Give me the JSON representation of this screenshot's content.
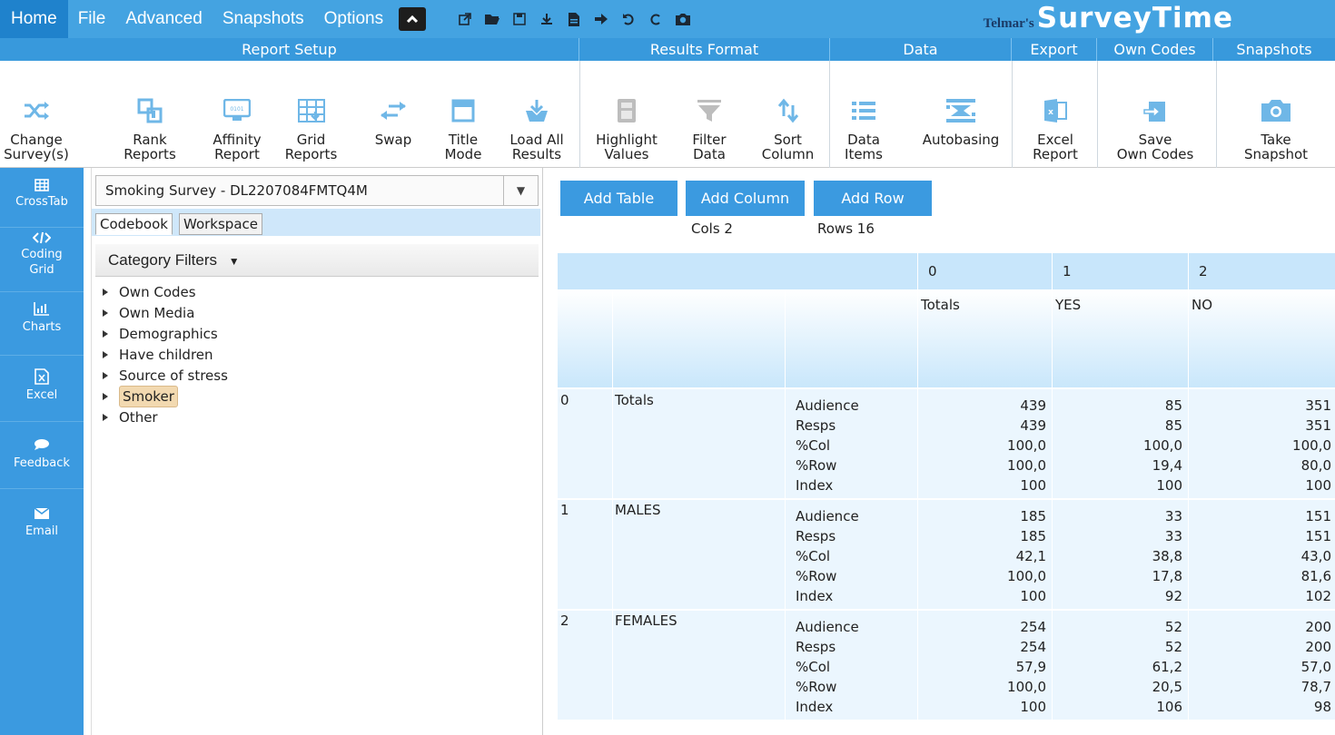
{
  "menu": {
    "tabs": [
      "Home",
      "File",
      "Advanced",
      "Snapshots",
      "Options"
    ],
    "brand_prefix": "Telmar's",
    "brand_name": "SurveyTime"
  },
  "ribbon_groups": [
    "Report Setup",
    "Results Format",
    "Data",
    "Export",
    "Own Codes",
    "Snapshots"
  ],
  "ribbon_buttons": [
    {
      "label": "Change\nSurvey(s)",
      "icon": "shuffle-icon"
    },
    {
      "label": "Rank\nReports",
      "icon": "rank-reports-icon"
    },
    {
      "label": "Affinity\nReport",
      "icon": "monitor-icon"
    },
    {
      "label": "Grid\nReports",
      "icon": "grid-reports-icon"
    },
    {
      "label": "Swap",
      "icon": "swap-icon"
    },
    {
      "label": "Title\nMode",
      "icon": "title-mode-icon"
    },
    {
      "label": "Load All\nResults",
      "icon": "load-all-icon"
    },
    {
      "label": "Highlight\nValues",
      "icon": "calculator-icon"
    },
    {
      "label": "Filter\nData",
      "icon": "filter-icon"
    },
    {
      "label": "Sort\nColumn",
      "icon": "sort-icon"
    },
    {
      "label": "Data\nItems",
      "icon": "list-icon"
    },
    {
      "label": "Autobasing",
      "icon": "autobasing-icon"
    },
    {
      "label": "Excel\nReport",
      "icon": "excel-icon"
    },
    {
      "label": "Save\nOwn Codes",
      "icon": "save-codes-icon"
    },
    {
      "label": "Take\nSnapshot",
      "icon": "camera-icon"
    }
  ],
  "sidenav": [
    {
      "label": "CrossTab",
      "icon": "table-icon"
    },
    {
      "label": "Coding\nGrid",
      "icon": "code-icon"
    },
    {
      "label": "Charts",
      "icon": "bar-chart-icon"
    },
    {
      "label": "Excel",
      "icon": "excel-file-icon"
    },
    {
      "label": "Feedback",
      "icon": "chat-icon"
    },
    {
      "label": "Email",
      "icon": "envelope-icon"
    }
  ],
  "codebook": {
    "survey": "Smoking Survey - DL2207084FMTQ4M",
    "tabs": [
      "Codebook",
      "Workspace"
    ],
    "filter_label": "Category Filters",
    "tree": [
      "Own Codes",
      "Own Media",
      "Demographics",
      "Have children",
      "Source of stress",
      "Smoker",
      "Other"
    ],
    "selected": "Smoker"
  },
  "actions": {
    "add_table": "Add Table",
    "add_column": "Add Column",
    "add_row": "Add Row",
    "cols": "Cols 2",
    "rows": "Rows 16"
  },
  "crosstab": {
    "col_indices": [
      "0",
      "1",
      "2"
    ],
    "col_labels": [
      "Totals",
      "YES",
      "NO"
    ],
    "stats": [
      "Audience",
      "Resps",
      "%Col",
      "%Row",
      "Index"
    ],
    "rows": [
      {
        "idx": "0",
        "label": "Totals",
        "values": [
          [
            "439",
            "439",
            "100,0",
            "100,0",
            "100"
          ],
          [
            "85",
            "85",
            "100,0",
            "19,4",
            "100"
          ],
          [
            "351",
            "351",
            "100,0",
            "80,0",
            "100"
          ]
        ]
      },
      {
        "idx": "1",
        "label": "MALES",
        "values": [
          [
            "185",
            "185",
            "42,1",
            "100,0",
            "100"
          ],
          [
            "33",
            "33",
            "38,8",
            "17,8",
            "92"
          ],
          [
            "151",
            "151",
            "43,0",
            "81,6",
            "102"
          ]
        ]
      },
      {
        "idx": "2",
        "label": "FEMALES",
        "values": [
          [
            "254",
            "254",
            "57,9",
            "100,0",
            "100"
          ],
          [
            "52",
            "52",
            "61,2",
            "20,5",
            "106"
          ],
          [
            "200",
            "200",
            "57,0",
            "78,7",
            "98"
          ]
        ]
      }
    ]
  }
}
